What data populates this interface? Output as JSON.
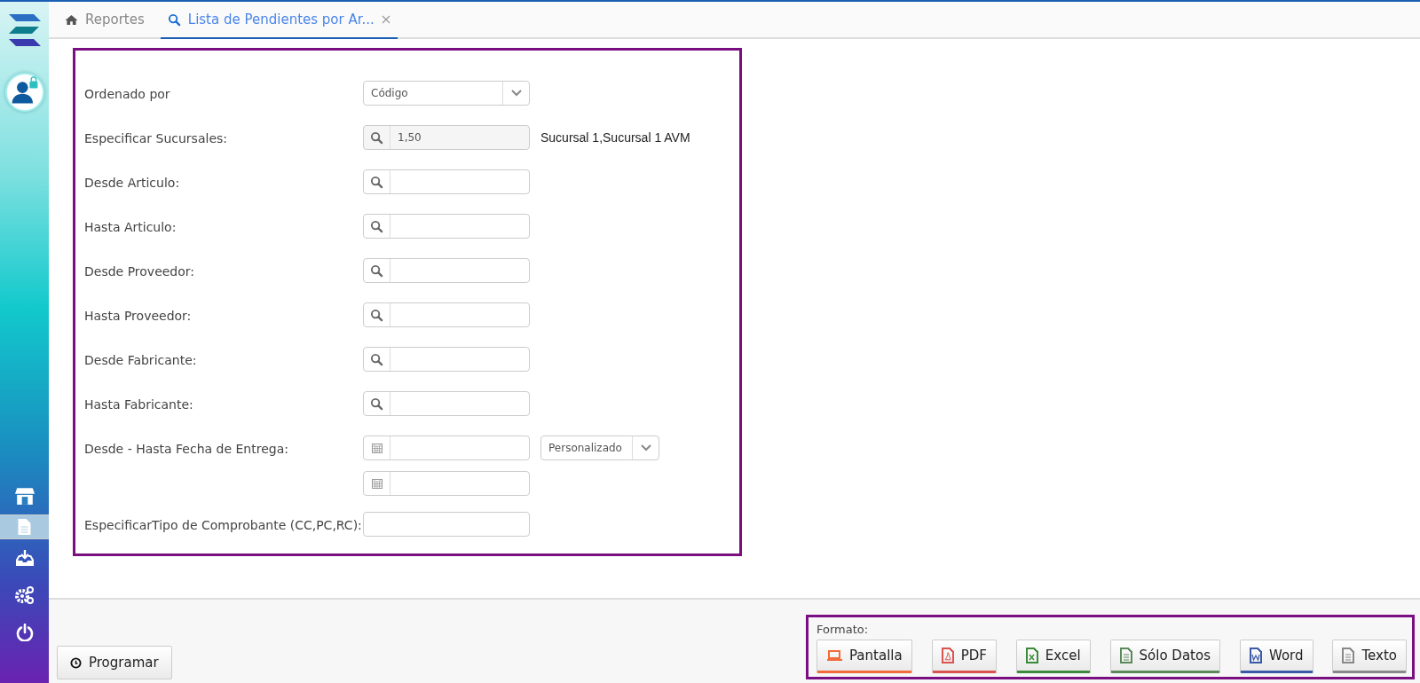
{
  "sidebar": {
    "items": [
      {
        "kind": "store",
        "selected": false
      },
      {
        "kind": "document",
        "selected": true
      },
      {
        "kind": "download",
        "selected": false
      },
      {
        "kind": "gears",
        "selected": false
      },
      {
        "kind": "power",
        "selected": false
      }
    ]
  },
  "tabs": [
    {
      "label": "Reportes",
      "kind": "home",
      "selected": false,
      "closable": false
    },
    {
      "label": "Lista de Pendientes por Ar...",
      "kind": "search",
      "selected": true,
      "closable": true
    }
  ],
  "form": {
    "rows": [
      {
        "label": "Ordenado por",
        "kind": "select",
        "value": "Código"
      },
      {
        "label": "Especificar Sucursales:",
        "kind": "lookup",
        "value": "1,50",
        "note": "Sucursal 1,Sucursal 1 AVM"
      },
      {
        "label": "Desde Articulo:",
        "kind": "search"
      },
      {
        "label": "Hasta Articulo:",
        "kind": "search"
      },
      {
        "label": "Desde Proveedor:",
        "kind": "search"
      },
      {
        "label": "Hasta Proveedor:",
        "kind": "search"
      },
      {
        "label": "Desde Fabricante:",
        "kind": "search"
      },
      {
        "label": "Hasta Fabricante:",
        "kind": "search"
      },
      {
        "label": "Desde - Hasta Fecha de Entrega:",
        "kind": "daterange",
        "preset": "Personalizado"
      },
      {
        "label": "EspecificarTipo de Comprobante (CC,PC,RC):",
        "kind": "text"
      }
    ]
  },
  "schedule_button": "Programar",
  "format": {
    "title": "Formato:",
    "buttons": [
      {
        "label": "Pantalla",
        "kind": "screen",
        "color": "#f26b3a"
      },
      {
        "label": "PDF",
        "kind": "pdf",
        "color": "#d9534f"
      },
      {
        "label": "Excel",
        "kind": "excel",
        "color": "#3c8a3c"
      },
      {
        "label": "Sólo Datos",
        "kind": "data",
        "color": "#5a8a5a"
      },
      {
        "label": "Word",
        "kind": "word",
        "color": "#3a5aa8"
      },
      {
        "label": "Texto",
        "kind": "text",
        "color": "#888888"
      }
    ]
  }
}
